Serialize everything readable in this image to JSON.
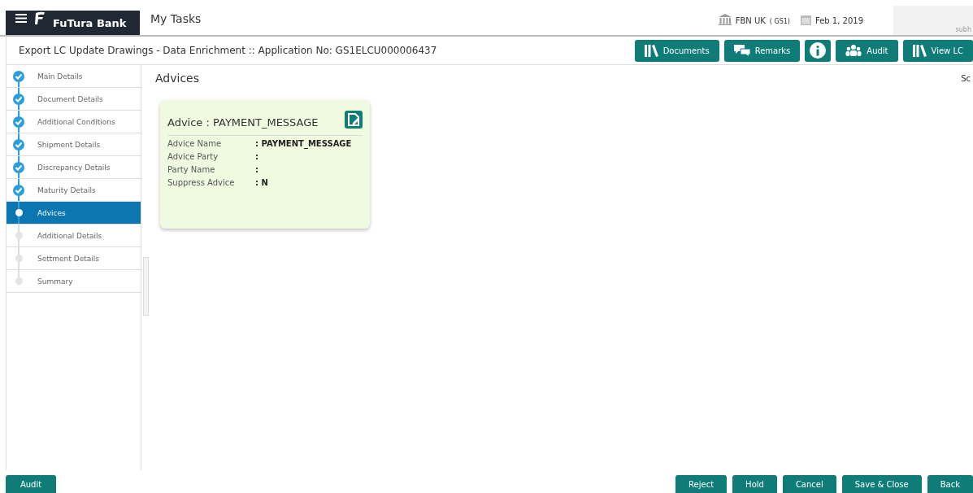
{
  "header": {
    "brand": "FuTura Bank",
    "title": "My Tasks",
    "branch": "FBN UK",
    "branch_code": "( GS1)",
    "date": "Feb 1, 2019",
    "user": "subh"
  },
  "subheader": {
    "title": "Export LC Update Drawings - Data Enrichment :: Application No: GS1ELCU000006437",
    "buttons": [
      {
        "kind": "books",
        "label": "Documents"
      },
      {
        "kind": "chat",
        "label": "Remarks"
      },
      {
        "kind": "info"
      },
      {
        "kind": "people",
        "label": "Audit"
      },
      {
        "kind": "books",
        "label": "View LC"
      }
    ]
  },
  "steps": [
    {
      "label": "Main Details",
      "kind": "done",
      "selected": false
    },
    {
      "label": "Document Details",
      "kind": "done",
      "selected": false
    },
    {
      "label": "Additional Conditions",
      "kind": "done",
      "selected": false
    },
    {
      "label": "Shipment Details",
      "kind": "done",
      "selected": false
    },
    {
      "label": "Discrepancy Details",
      "kind": "done",
      "selected": false
    },
    {
      "label": "Maturity Details",
      "kind": "done",
      "selected": false
    },
    {
      "label": "Advices",
      "kind": "current",
      "selected": true
    },
    {
      "label": "Additional Details",
      "kind": "pending",
      "selected": false
    },
    {
      "label": "Settment Details",
      "kind": "pending",
      "selected": false
    },
    {
      "label": "Summary",
      "kind": "pending",
      "selected": false
    }
  ],
  "content": {
    "heading": "Advices",
    "corner_text": "Sc",
    "card": {
      "title": "Advice : PAYMENT_MESSAGE",
      "fields": [
        {
          "label": "Advice Name",
          "value": ": PAYMENT_MESSAGE"
        },
        {
          "label": "Advice Party",
          "value": ":"
        },
        {
          "label": "Party Name",
          "value": ":"
        },
        {
          "label": "Suppress Advice",
          "value": ": N"
        }
      ]
    }
  },
  "footer": {
    "left_buttons": [
      "Audit"
    ],
    "right_buttons": [
      "Reject",
      "Hold",
      "Cancel",
      "Save & Close",
      "Back"
    ]
  }
}
